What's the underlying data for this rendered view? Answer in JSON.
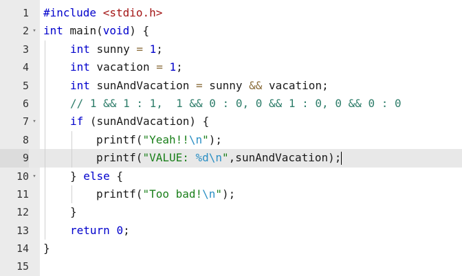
{
  "editor": {
    "active_line": 9,
    "lines": [
      {
        "num": "1",
        "fold": false
      },
      {
        "num": "2",
        "fold": true
      },
      {
        "num": "3",
        "fold": false
      },
      {
        "num": "4",
        "fold": false
      },
      {
        "num": "5",
        "fold": false
      },
      {
        "num": "6",
        "fold": false
      },
      {
        "num": "7",
        "fold": true
      },
      {
        "num": "8",
        "fold": false
      },
      {
        "num": "9",
        "fold": false
      },
      {
        "num": "10",
        "fold": true
      },
      {
        "num": "11",
        "fold": false
      },
      {
        "num": "12",
        "fold": false
      },
      {
        "num": "13",
        "fold": false
      },
      {
        "num": "14",
        "fold": false
      },
      {
        "num": "15",
        "fold": false
      }
    ],
    "fold_glyph": "▾",
    "code": {
      "l1": {
        "directive": "#include",
        "header": "<stdio.h>"
      },
      "l2": {
        "type": "int",
        "name": " main(",
        "param": "void",
        "rest": ") {"
      },
      "l3": {
        "type": "int",
        "rest1": " sunny ",
        "op": "=",
        "sp": " ",
        "value": "1",
        "end": ";"
      },
      "l4": {
        "type": "int",
        "rest1": " vacation ",
        "op": "=",
        "sp": " ",
        "value": "1",
        "end": ";"
      },
      "l5": {
        "type": "int",
        "rest1": " sunAndVacation ",
        "op": "=",
        "rest2": " sunny ",
        "op2": "&&",
        "rest3": " vacation;"
      },
      "l6": {
        "comment": "// 1 && 1 : 1,  1 && 0 : 0, 0 && 1 : 0, 0 && 0 : 0"
      },
      "l7": {
        "kw": "if",
        "rest": " (sunAndVacation) {"
      },
      "l8": {
        "fn": "printf(",
        "str1": "\"Yeah!!",
        "esc": "\\n",
        "str2": "\"",
        "end": ");"
      },
      "l9": {
        "fn": "printf(",
        "str1": "\"VALUE: ",
        "esc": "%d\\n",
        "str2": "\"",
        "end": ",sunAndVacation);"
      },
      "l10": {
        "brace": "} ",
        "kw": "else",
        "rest": " {"
      },
      "l11": {
        "fn": "printf(",
        "str1": "\"Too bad!",
        "esc": "\\n",
        "str2": "\"",
        "end": ");"
      },
      "l12": {
        "brace": "}"
      },
      "l13": {
        "kw": "return",
        "sp": " ",
        "value": "0",
        "end": ";"
      },
      "l14": {
        "brace": "}"
      },
      "l15": {
        "text": ""
      }
    }
  }
}
